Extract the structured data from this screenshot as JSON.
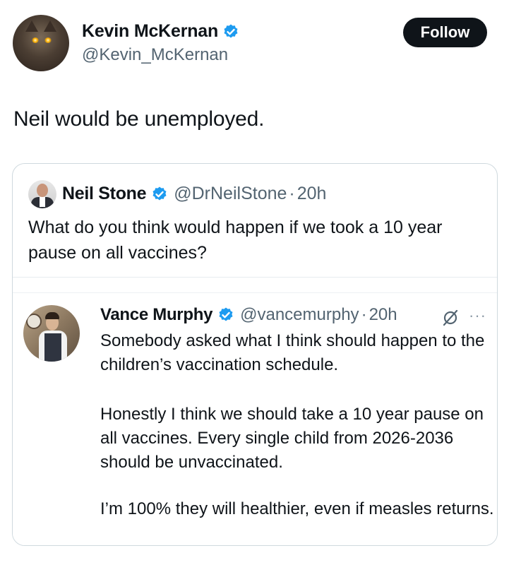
{
  "author": {
    "name": "Kevin McKernan",
    "handle": "@Kevin_McKernan",
    "verified": true,
    "avatar_icon": "cat-avatar"
  },
  "follow_button": {
    "label": "Follow"
  },
  "tweet": {
    "text": "Neil would be unemployed."
  },
  "quoted": {
    "name": "Neil Stone",
    "handle": "@DrNeilStone",
    "time": "20h",
    "separator": "·",
    "verified": true,
    "text": "What do you think would happen if we took a 10 year pause on all vaccines?"
  },
  "embedded": {
    "name": "Vance Murphy",
    "handle": "@vancemurphy",
    "time": "20h",
    "separator": "·",
    "verified": true,
    "more_label": "···",
    "paragraphs": [
      "Somebody asked what I think should happen to the children’s vaccination schedule.",
      "Honestly I think we should take a 10 year pause on all vaccines. Every single child from 2026-2036 should be unvaccinated.",
      "I’m 100% they will healthier, even if measles returns."
    ]
  },
  "colors": {
    "text": "#0f1419",
    "secondary": "#536471",
    "verified_badge": "#1d9bf0",
    "border": "#cfd9de",
    "follow_bg": "#0f1419"
  }
}
